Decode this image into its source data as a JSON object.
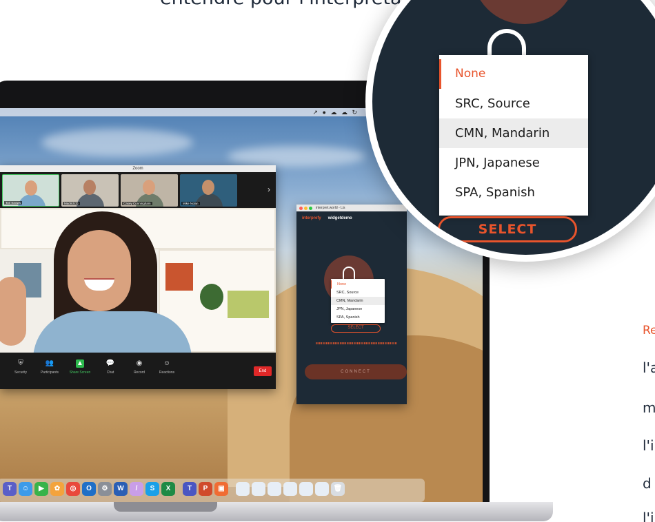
{
  "heading_fragment": "entendre pour l'interprétation.",
  "side_copy": {
    "line1": "Re",
    "line2": "l'a",
    "line3": "m",
    "line4": "l'i",
    "line5": "d",
    "line6": "l'i"
  },
  "menubar_icons": "↗ ● ☁ ☁ ↻",
  "zoom": {
    "window_title": "Zoom",
    "participants": [
      {
        "name": "Tori Knows"
      },
      {
        "name": "Madrid (3)"
      },
      {
        "name": "Casey Cunningham"
      },
      {
        "name": "Mike Nolan"
      }
    ],
    "toolbar": [
      {
        "label": "Security",
        "icon": "shield-icon"
      },
      {
        "label": "Participants",
        "icon": "people-icon"
      },
      {
        "label": "Share Screen",
        "icon": "share-screen-icon"
      },
      {
        "label": "Chat",
        "icon": "chat-icon"
      },
      {
        "label": "Record",
        "icon": "record-icon"
      },
      {
        "label": "Reactions",
        "icon": "reactions-icon"
      }
    ],
    "end_label": "End"
  },
  "interpretation_widget": {
    "window_title": "interpret.world - Lis",
    "brand": "interprefy",
    "widget_name": "widgetdemo",
    "languages": [
      "None",
      "SRC, Source",
      "CMN, Mandarin",
      "JPN, Japanese",
      "SPA, Spanish"
    ],
    "highlighted_language": "CMN, Mandarin",
    "select_label": "SELECT",
    "connect_label": "CONNECT"
  },
  "magnified_widget": {
    "languages": [
      "None",
      "SRC, Source",
      "CMN, Mandarin",
      "JPN, Japanese",
      "SPA, Spanish"
    ],
    "select_label": "SELECT"
  },
  "dock_apps": [
    "teams",
    "finder",
    "facetime",
    "photos",
    "chrome",
    "outlook",
    "settings",
    "word",
    "pen",
    "skype",
    "excel",
    "teams2",
    "powerpoint",
    "files",
    "folder",
    "folder",
    "folder",
    "folder",
    "folder",
    "folder",
    "trash"
  ],
  "colors": {
    "accent": "#e8542c",
    "widget_bg": "#1d2a36",
    "zoom_share_green": "#2db94d",
    "end_red": "#e02828"
  }
}
